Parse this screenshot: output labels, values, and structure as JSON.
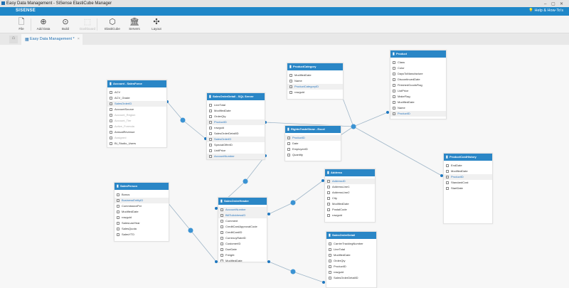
{
  "window": {
    "title": "Easy Data Management - SiSense ElastiCube Manager"
  },
  "brand": {
    "logo": "SISENSE",
    "help": "Help & How-To's",
    "accent": "#1f87c8"
  },
  "toolbar": [
    {
      "label": "File",
      "icon": "file-icon",
      "enabled": true
    },
    {
      "label": "Add Data",
      "icon": "plus-circle-icon",
      "enabled": true
    },
    {
      "label": "Build",
      "icon": "play-circle-icon",
      "enabled": true
    },
    {
      "label": "Dashboard",
      "icon": "dashboard-icon",
      "enabled": false
    },
    {
      "label": "ElastiCube",
      "icon": "cube-icon",
      "enabled": true
    },
    {
      "label": "Servers",
      "icon": "servers-icon",
      "enabled": true
    },
    {
      "label": "Layout",
      "icon": "layout-icon",
      "enabled": true
    }
  ],
  "tab": {
    "label": "Easy Data Management *"
  },
  "tables": [
    {
      "name": "Account - SalesForce",
      "rows": [
        "ACV",
        "ACV_Grade",
        "SalesOrderID",
        "AccountSource",
        "Account_Region",
        "Account_Tier",
        "Active_Formula",
        "AnnualRevenue",
        "Assigned",
        "BI_Studio_Users"
      ],
      "highlight": [
        "SalesOrderID"
      ],
      "dim": [
        "Account_Region",
        "Account_Tier",
        "Active_Formula",
        "Assigned"
      ]
    },
    {
      "name": "SalesOrderDetail - SQL Server",
      "rows": [
        "LineTotal",
        "ModifiedDate",
        "OrderQty",
        "ProductID",
        "rowguid",
        "SalesOrderDetailID",
        "SalesOrderID",
        "SpecialOfferID",
        "UnitPrice",
        "AccountNumber"
      ],
      "highlight": [
        "ProductID",
        "SalesOrderID",
        "AccountNumber"
      ]
    },
    {
      "name": "ProductCategory",
      "rows": [
        "ModifiedDate",
        "Name",
        "ProductCategoryID",
        "rowguid"
      ],
      "highlight": [
        "ProductCategoryID"
      ]
    },
    {
      "name": "Product",
      "rows": [
        "Class",
        "Color",
        "DaysToManufacture",
        "DiscontinuedDate",
        "FinishedGoodsFlag",
        "ListPrice",
        "MakeFlag",
        "ModifiedDate",
        "Name",
        "ProductID"
      ],
      "highlight": [
        "ProductID"
      ]
    },
    {
      "name": "RightsTradeShow - Excel",
      "rows": [
        "ProductID",
        "Date",
        "EmployeeID",
        "Quantity"
      ],
      "highlight": [
        "ProductID"
      ]
    },
    {
      "name": "ProductCostHistory",
      "rows": [
        "EndDate",
        "ModifiedDate",
        "ProductID",
        "StandardCost",
        "StartDate"
      ],
      "highlight": [
        "ProductID"
      ]
    },
    {
      "name": "SalesPerson",
      "rows": [
        "Bonus",
        "BusinessEntityID",
        "CommissionPct",
        "ModifiedDate",
        "rowguid",
        "SalesLastYear",
        "SalesQuota",
        "SalesYTD"
      ],
      "highlight": [
        "BusinessEntityID"
      ]
    },
    {
      "name": "SalesOrderHeader",
      "rows": [
        "AccountNumber",
        "BillToAddressID",
        "Comment",
        "CreditCardApprovalCode",
        "CreditCardID",
        "CurrencyRateID",
        "CustomerID",
        "DueDate",
        "Freight",
        "ModifiedDate"
      ],
      "highlight": [
        "AccountNumber",
        "BillToAddressID"
      ]
    },
    {
      "name": "Address",
      "rows": [
        "AddressID",
        "AddressLine1",
        "AddressLine2",
        "City",
        "ModifiedDate",
        "PostalCode",
        "rowguid"
      ],
      "highlight": [
        "AddressID"
      ]
    },
    {
      "name": "SalesOrderDetail",
      "rows": [
        "CarrierTrackingNumber",
        "LineTotal",
        "ModifiedDate",
        "OrderQty",
        "ProductID",
        "rowguid",
        "SalesOrderDetailID"
      ],
      "highlight": []
    }
  ]
}
